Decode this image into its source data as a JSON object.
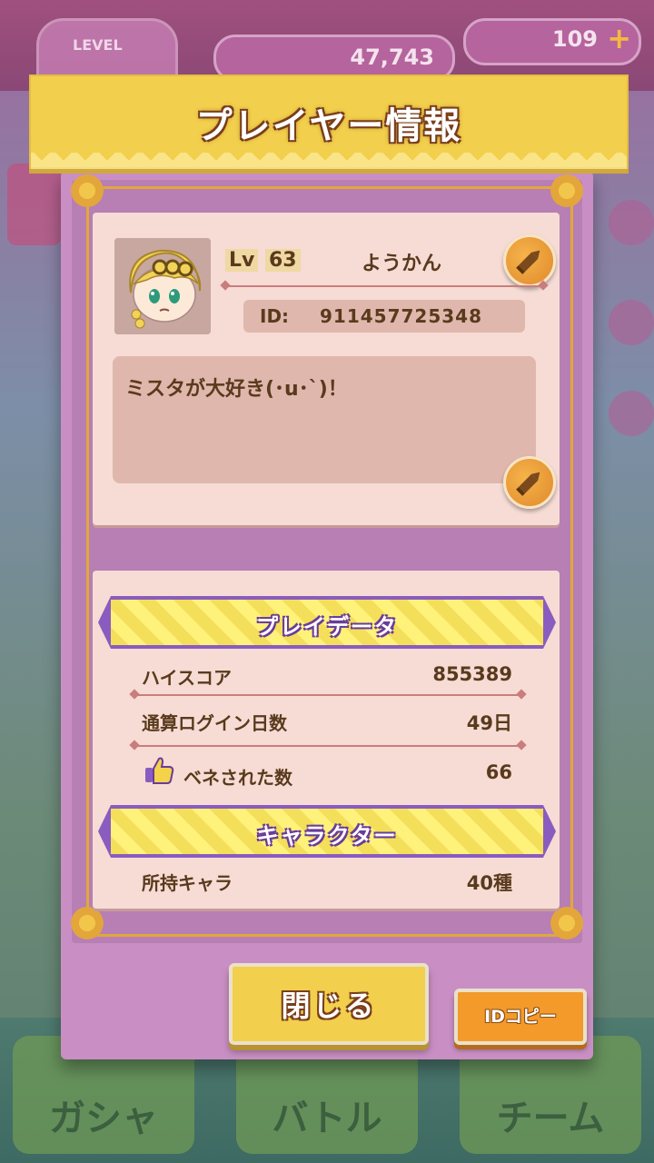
{
  "background": {
    "level_label": "LEVEL",
    "coins": "47,743",
    "gems": "109",
    "gem_plus": "+",
    "tabs": [
      "ガシャ",
      "バトル",
      "チーム"
    ]
  },
  "dialog": {
    "title": "プレイヤー情報"
  },
  "profile": {
    "lv_label": "Lv",
    "level": "63",
    "name": "ようかん",
    "id_label": "ID:",
    "id_value": "911457725348",
    "comment": "ミスタが大好き(･u･`)！",
    "avatar_icon": "character-avatar-icon",
    "edit_icon": "pencil-icon"
  },
  "play_data": {
    "section_title": "プレイデータ",
    "rows": [
      {
        "label": "ハイスコア",
        "value": "855389"
      },
      {
        "label": "通算ログイン日数",
        "value": "49日"
      },
      {
        "label": "ベネされた数",
        "value": "66",
        "icon": "thumbs-up-icon"
      }
    ]
  },
  "character": {
    "section_title": "キャラクター",
    "rows": [
      {
        "label": "所持キャラ",
        "value": "40種"
      }
    ]
  },
  "buttons": {
    "close_label": "閉じる",
    "copy_id_label": "IDコピー"
  },
  "colors": {
    "header_yellow": "#f2cf4c",
    "panel_purple": "#c98fc4",
    "card_pink": "#f6dcd5",
    "text_brown": "#5a3a1c",
    "ribbon_purple": "#8a5cc0",
    "copy_orange": "#f39a2a"
  }
}
